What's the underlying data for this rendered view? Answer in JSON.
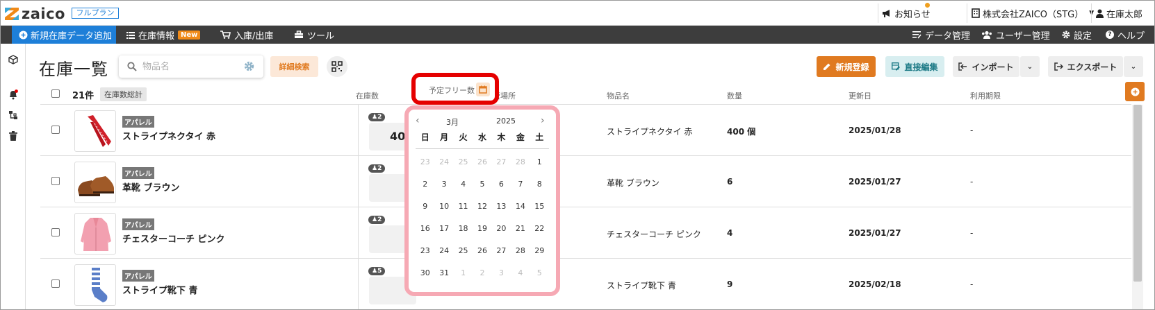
{
  "app": {
    "logo_text": "zaico",
    "plan_badge": "フルプラン",
    "notifications_label": "お知らせ",
    "company_label": "株式会社ZAICO（STG）",
    "user_label": "在庫太郎"
  },
  "nav": {
    "add_label": "新規在庫データ追加",
    "inventory_label": "在庫情報",
    "new_badge": "New",
    "inout_label": "入庫/出庫",
    "tools_label": "ツール",
    "data_mgmt_label": "データ管理",
    "user_mgmt_label": "ユーザー管理",
    "settings_label": "設定",
    "help_label": "ヘルプ"
  },
  "page": {
    "title": "在庫一覧",
    "search_placeholder": "物品名",
    "detail_search_label": "詳細検索",
    "new_register_label": "新規登録",
    "direct_edit_label": "直接編集",
    "import_label": "インポート",
    "export_label": "エクスポート"
  },
  "table": {
    "count_label": "21件",
    "count_total_label": "在庫数総計",
    "columns": {
      "stock": "在庫数",
      "free": "予定フリー数",
      "location": "保管場所",
      "name": "物品名",
      "quantity": "数量",
      "updated": "更新日",
      "expiry": "利用期限"
    },
    "rows": [
      {
        "category": "アパレル",
        "name": "ストライプネクタイ 赤",
        "badge": "2",
        "stock": "40",
        "item_name": "ストライプネクタイ 赤",
        "quantity": "400 個",
        "updated": "2025/01/28",
        "expiry": "-"
      },
      {
        "category": "アパレル",
        "name": "革靴 ブラウン",
        "badge": "2",
        "stock": "",
        "item_name": "革靴 ブラウン",
        "quantity": "6",
        "updated": "2025/01/27",
        "expiry": "-"
      },
      {
        "category": "アパレル",
        "name": "チェスターコーチ ピンク",
        "badge": "2",
        "stock": "",
        "item_name": "チェスターコーチ ピンク",
        "quantity": "4",
        "updated": "2025/01/27",
        "expiry": "-"
      },
      {
        "category": "アパレル",
        "name": "ストライプ靴下 青",
        "badge": "5",
        "stock": "",
        "item_name": "ストライプ靴下 青",
        "quantity": "9",
        "updated": "2025/02/18",
        "expiry": "-"
      }
    ]
  },
  "calendar": {
    "month": "3月",
    "year": "2025",
    "weekdays": [
      "日",
      "月",
      "火",
      "水",
      "木",
      "金",
      "土"
    ],
    "days": [
      {
        "d": "23",
        "muted": true
      },
      {
        "d": "24",
        "muted": true
      },
      {
        "d": "25",
        "muted": true
      },
      {
        "d": "26",
        "muted": true
      },
      {
        "d": "27",
        "muted": true
      },
      {
        "d": "28",
        "muted": true
      },
      {
        "d": "1",
        "muted": false
      },
      {
        "d": "2",
        "muted": false
      },
      {
        "d": "3",
        "muted": false
      },
      {
        "d": "4",
        "muted": false
      },
      {
        "d": "5",
        "muted": false
      },
      {
        "d": "6",
        "muted": false
      },
      {
        "d": "7",
        "muted": false
      },
      {
        "d": "8",
        "muted": false
      },
      {
        "d": "9",
        "muted": false
      },
      {
        "d": "10",
        "muted": false
      },
      {
        "d": "11",
        "muted": false
      },
      {
        "d": "12",
        "muted": false
      },
      {
        "d": "13",
        "muted": false
      },
      {
        "d": "14",
        "muted": false
      },
      {
        "d": "15",
        "muted": false
      },
      {
        "d": "16",
        "muted": false
      },
      {
        "d": "17",
        "muted": false
      },
      {
        "d": "18",
        "muted": false
      },
      {
        "d": "19",
        "muted": false
      },
      {
        "d": "20",
        "muted": false
      },
      {
        "d": "21",
        "muted": false
      },
      {
        "d": "22",
        "muted": false
      },
      {
        "d": "23",
        "muted": false
      },
      {
        "d": "24",
        "muted": false
      },
      {
        "d": "25",
        "muted": false
      },
      {
        "d": "26",
        "muted": false
      },
      {
        "d": "27",
        "muted": false
      },
      {
        "d": "28",
        "muted": false
      },
      {
        "d": "29",
        "muted": false
      },
      {
        "d": "30",
        "muted": false
      },
      {
        "d": "31",
        "muted": false
      },
      {
        "d": "1",
        "muted": true
      },
      {
        "d": "2",
        "muted": true
      },
      {
        "d": "3",
        "muted": true
      },
      {
        "d": "4",
        "muted": true
      },
      {
        "d": "5",
        "muted": true
      }
    ]
  },
  "icons": {
    "megaphone": "megaphone-icon",
    "building": "building-icon",
    "user": "user-icon",
    "plus_circle": "plus-circle-icon",
    "list": "list-icon",
    "cart": "cart-icon",
    "toolbox": "toolbox-icon",
    "search": "search-icon",
    "gear": "gear-icon",
    "qr": "qr-code-icon",
    "calendar": "calendar-icon"
  },
  "colors": {
    "brand_orange": "#e07a20",
    "nav_dark": "#3d3d3d",
    "nav_blue": "#1e7fd8",
    "highlight_red": "#e50000",
    "calendar_border": "#f6a9b4",
    "edit_teal": "#1c7a86"
  }
}
